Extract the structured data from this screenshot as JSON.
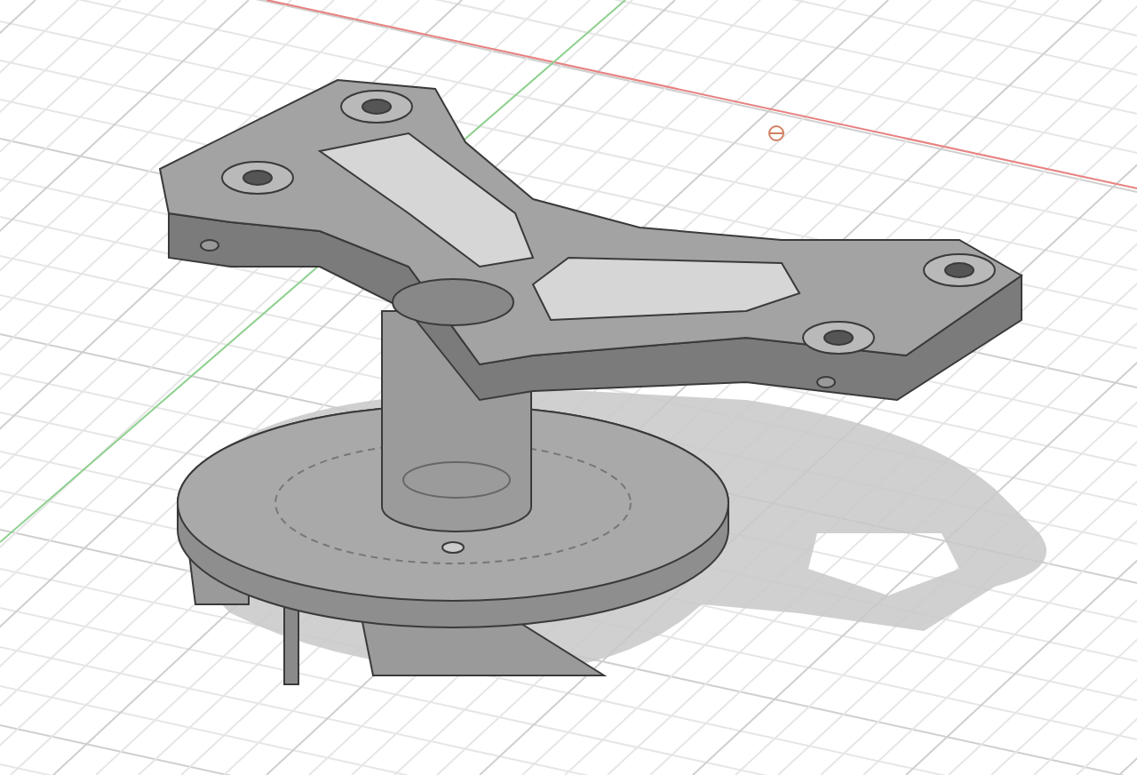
{
  "viewport": {
    "grid": true,
    "shadow": true
  }
}
